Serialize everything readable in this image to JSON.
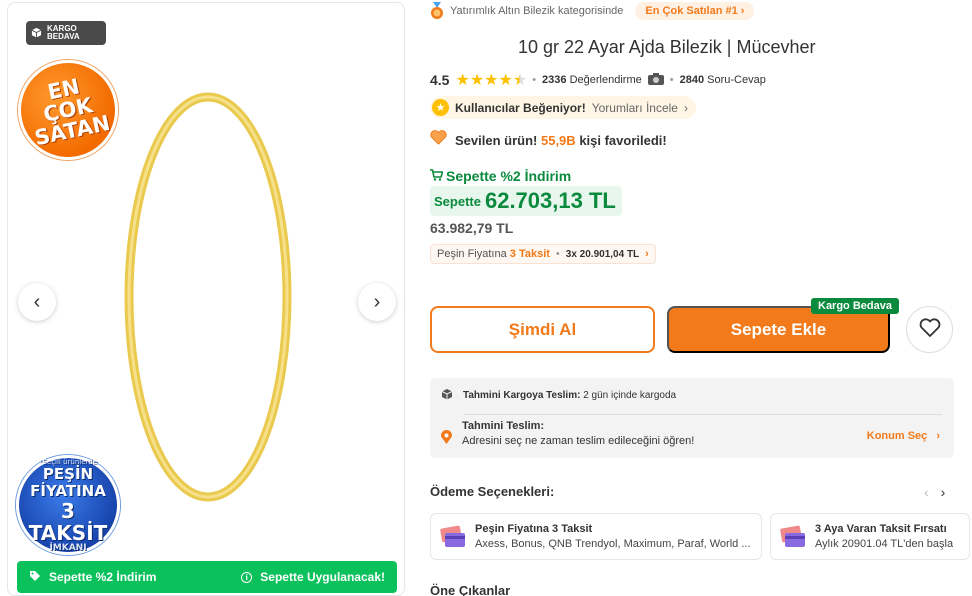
{
  "gallery": {
    "kargo_badge_line1": "KARGO",
    "kargo_badge_line2": "BEDAVA",
    "sticker_encok": "EN ÇOK SATAN",
    "sticker_pesin_small": "*Seçili ürünlerde",
    "sticker_pesin_line1": "PEŞİN",
    "sticker_pesin_line2": "FİYATINA",
    "sticker_pesin_line3": "3 TAKSİT",
    "sticker_pesin_line4": "İMKANI",
    "sepette_left": "Sepette %2 İndirim",
    "sepette_right": "Sepette Uygulanacak!"
  },
  "category": {
    "text": "Yatırımlık Altın Bilezik kategorisinde",
    "chip": "En Çok Satılan #1"
  },
  "product": {
    "title": "10 gr 22 Ayar Ajda Bilezik | Mücevher",
    "rating": "4.5",
    "reviews_count": "2336",
    "reviews_label": "Değerlendirme",
    "qa_count": "2840",
    "qa_label": "Soru-Cevap",
    "liked_text": "Kullanıcılar Beğeniyor!",
    "liked_link": "Yorumları İncele",
    "fav_prefix": "Sevilen ürün!",
    "fav_count": "55,9B",
    "fav_suffix": "kişi favoriledi!",
    "sepette_indirim": "Sepette %2 İndirim",
    "sepette_label": "Sepette",
    "sepette_price": "62.703,13 TL",
    "old_price": "63.982,79 TL",
    "taksit_prefix": "Peşin Fiyatına",
    "taksit_orange": "3 Taksit",
    "taksit_detail": "3x 20.901,04 TL"
  },
  "actions": {
    "buy_now": "Şimdi Al",
    "add_to_cart": "Sepete Ekle",
    "kargo_tag": "Kargo Bedava"
  },
  "delivery": {
    "cargo_label": "Tahmini Kargoya Teslim:",
    "cargo_value": "2 gün içinde kargoda",
    "teslim_label": "Tahmini Teslim:",
    "teslim_text": "Adresini seç ne zaman teslim edileceğini öğren!",
    "konum_sec": "Konum Seç"
  },
  "payment": {
    "title": "Ödeme Seçenekleri:",
    "card1_title": "Peşin Fiyatına 3 Taksit",
    "card1_text": "Axess, Bonus, QNB Trendyol, Maximum, Paraf, World ...",
    "card2_title": "3 Aya Varan Taksit Fırsatı",
    "card2_text": "Aylık 20901.04 TL'den başla"
  },
  "highlights": {
    "title": "Öne Çıkanlar"
  },
  "colors": {
    "accent": "#f27a1a",
    "green": "#0a8a3c",
    "sepette_bar": "#0bc15c"
  }
}
